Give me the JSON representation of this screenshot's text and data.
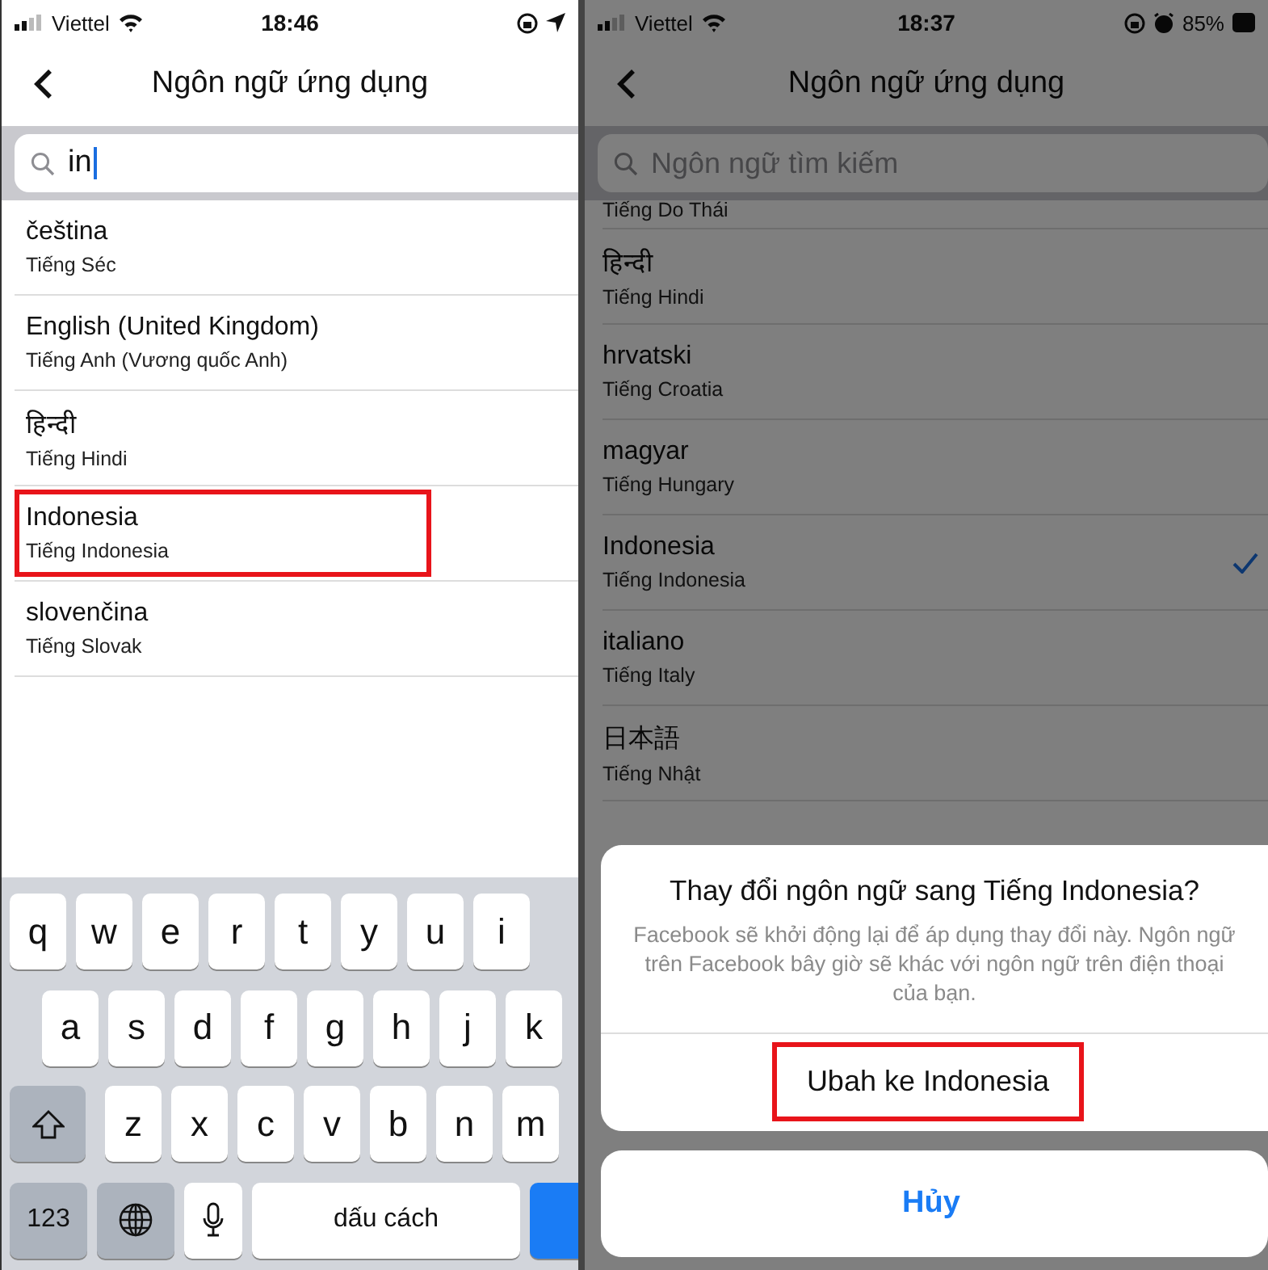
{
  "left_screen": {
    "status_bar": {
      "carrier": "Viettel",
      "time": "18:46"
    },
    "title": "Ngôn ngữ ứng dụng",
    "search": {
      "value": "in"
    },
    "languages": [
      {
        "name": "čeština",
        "translation": "Tiếng Séc",
        "highlighted": false
      },
      {
        "name": "English (United Kingdom)",
        "translation": "Tiếng Anh (Vương quốc Anh)",
        "highlighted": false
      },
      {
        "name": "हिन्दी",
        "translation": "Tiếng Hindi",
        "highlighted": false
      },
      {
        "name": "Indonesia",
        "translation": "Tiếng Indonesia",
        "highlighted": true
      },
      {
        "name": "slovenčina",
        "translation": "Tiếng Slovak",
        "highlighted": false
      }
    ],
    "keyboard": {
      "rows": [
        [
          {
            "kind": "letter",
            "label": "q"
          },
          {
            "kind": "letter",
            "label": "w"
          },
          {
            "kind": "letter",
            "label": "e"
          },
          {
            "kind": "letter",
            "label": "r"
          },
          {
            "kind": "letter",
            "label": "t"
          },
          {
            "kind": "letter",
            "label": "y"
          },
          {
            "kind": "letter",
            "label": "u"
          },
          {
            "kind": "letter",
            "label": "i"
          }
        ],
        [
          {
            "kind": "letter",
            "label": "a"
          },
          {
            "kind": "letter",
            "label": "s"
          },
          {
            "kind": "letter",
            "label": "d"
          },
          {
            "kind": "letter",
            "label": "f"
          },
          {
            "kind": "letter",
            "label": "g"
          },
          {
            "kind": "letter",
            "label": "h"
          },
          {
            "kind": "letter",
            "label": "j"
          },
          {
            "kind": "letter",
            "label": "k"
          }
        ],
        [
          {
            "kind": "shift"
          },
          {
            "kind": "letter",
            "label": "z"
          },
          {
            "kind": "letter",
            "label": "x"
          },
          {
            "kind": "letter",
            "label": "c"
          },
          {
            "kind": "letter",
            "label": "v"
          },
          {
            "kind": "letter",
            "label": "b"
          },
          {
            "kind": "letter",
            "label": "n"
          },
          {
            "kind": "letter",
            "label": "m"
          }
        ]
      ],
      "bottom_row": {
        "numbers_key": "123",
        "space_key": "dấu cách"
      }
    }
  },
  "right_screen": {
    "status_bar": {
      "carrier": "Viettel",
      "time": "18:37",
      "battery": "85%"
    },
    "title": "Ngôn ngữ ứng dụng",
    "search": {
      "placeholder": "Ngôn ngữ tìm kiếm"
    },
    "languages": [
      {
        "translation": "Tiếng Do Thái",
        "checked": false
      },
      {
        "name": "हिन्दी",
        "translation": "Tiếng Hindi",
        "checked": false
      },
      {
        "name": "hrvatski",
        "translation": "Tiếng Croatia",
        "checked": false
      },
      {
        "name": "magyar",
        "translation": "Tiếng Hungary",
        "checked": false
      },
      {
        "name": "Indonesia",
        "translation": "Tiếng Indonesia",
        "checked": true
      },
      {
        "name": "italiano",
        "translation": "Tiếng Italy",
        "checked": false
      },
      {
        "name": "日本語",
        "translation": "Tiếng Nhật",
        "checked": false
      }
    ],
    "dialog": {
      "title": "Thay đổi ngôn ngữ sang Tiếng Indonesia?",
      "message": "Facebook sẽ khởi động lại để áp dụng thay đổi này. Ngôn ngữ trên Facebook bây giờ sẽ khác với ngôn ngữ trên điện thoại của bạn.",
      "confirm": {
        "label": "Ubah ke Indonesia",
        "highlighted": true
      },
      "cancel": "Hủy"
    }
  }
}
